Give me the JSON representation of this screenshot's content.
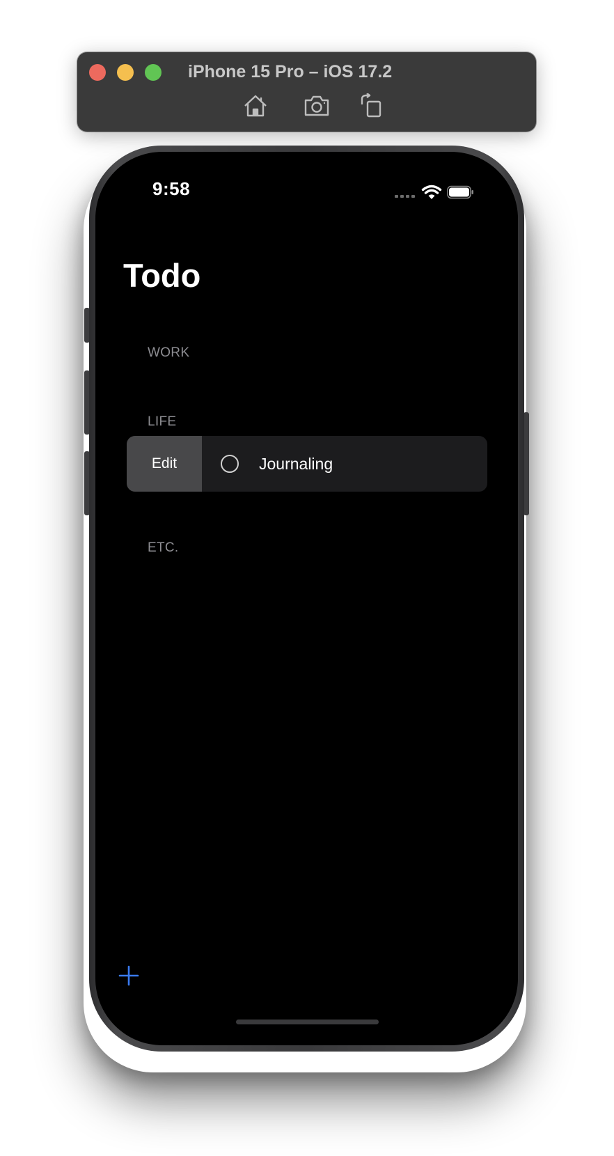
{
  "simulator": {
    "title": "iPhone 15 Pro – iOS 17.2",
    "toolbar": [
      "home-icon",
      "screenshot-icon",
      "rotate-icon"
    ]
  },
  "status_bar": {
    "time": "9:58"
  },
  "app": {
    "title": "Todo",
    "sections": [
      {
        "header": "WORK",
        "items": []
      },
      {
        "header": "LIFE",
        "items": [
          {
            "label": "Journaling",
            "done": false,
            "swipe_action": "Edit"
          }
        ]
      },
      {
        "header": "ETC.",
        "items": []
      }
    ],
    "add_icon": "plus-icon"
  },
  "colors": {
    "accent": "#3a7bf0",
    "background": "#000000",
    "row_background": "#1c1c1e",
    "edit_action": "#48484a",
    "section_header": "#8e8e93"
  }
}
